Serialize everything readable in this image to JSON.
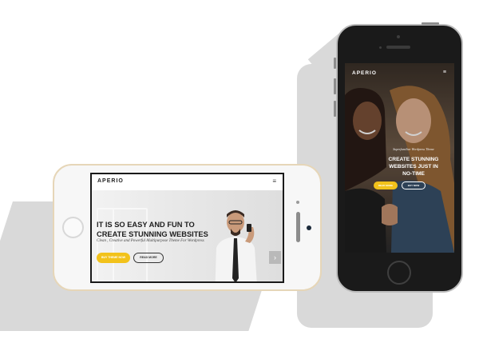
{
  "colors": {
    "accent_yellow": "#f2c21b",
    "shadow_gray": "#d9d9d9",
    "white_phone_trim": "#e6d6b8",
    "black_phone_body": "#1a1a1a"
  },
  "landscape_phone": {
    "brand": "APERIO",
    "menu_icon": "hamburger-icon",
    "headline_line1": "IT IS SO EASY AND FUN TO",
    "headline_line2": "CREATE STUNNING WEBSITES",
    "subtitle": "Clean , Creative and Powerful Multipurpose Theme For Wordpress",
    "primary_button": "BUY THEME NOW",
    "secondary_button": "READ MORE",
    "next_arrow": "›"
  },
  "portrait_phone": {
    "brand": "APERIO",
    "menu_icon": "hamburger-icon",
    "tagline": "Superfamiliar Wordpress Theme",
    "headline_line1": "CREATE STUNNING",
    "headline_line2": "WEBSITES JUST IN",
    "headline_line3": "NO-TIME",
    "primary_button": "READ MORE",
    "secondary_button": "BUY NOW",
    "slider_dots": 2,
    "active_dot": 2
  }
}
